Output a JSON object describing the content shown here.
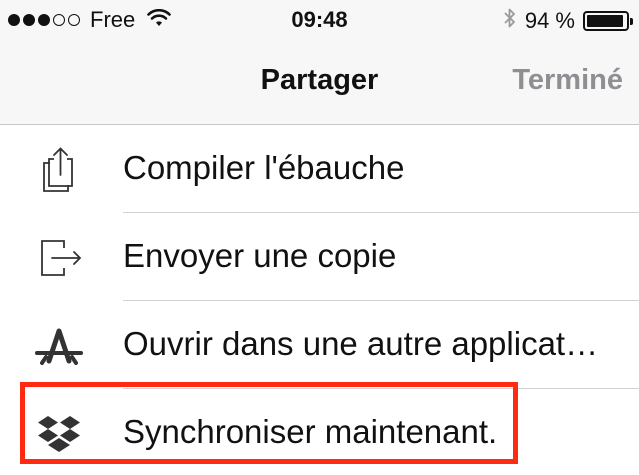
{
  "status_bar": {
    "carrier": "Free",
    "time": "09:48",
    "battery_text": "94 %",
    "battery_level": 0.94,
    "signal_bars_filled": 3,
    "signal_bars_total": 5
  },
  "nav": {
    "title": "Partager",
    "done_label": "Terminé"
  },
  "actions": [
    {
      "label": "Compiler l'ébauche",
      "icon": "share-export-icon"
    },
    {
      "label": "Envoyer une copie",
      "icon": "send-copy-icon"
    },
    {
      "label": "Ouvrir dans une autre applicat…",
      "icon": "open-in-app-icon"
    },
    {
      "label": "Synchroniser maintenant.",
      "icon": "dropbox-icon"
    }
  ],
  "colors": {
    "highlight": "#ff2a12",
    "icon": "#333333",
    "done_disabled": "#8e8e93"
  }
}
